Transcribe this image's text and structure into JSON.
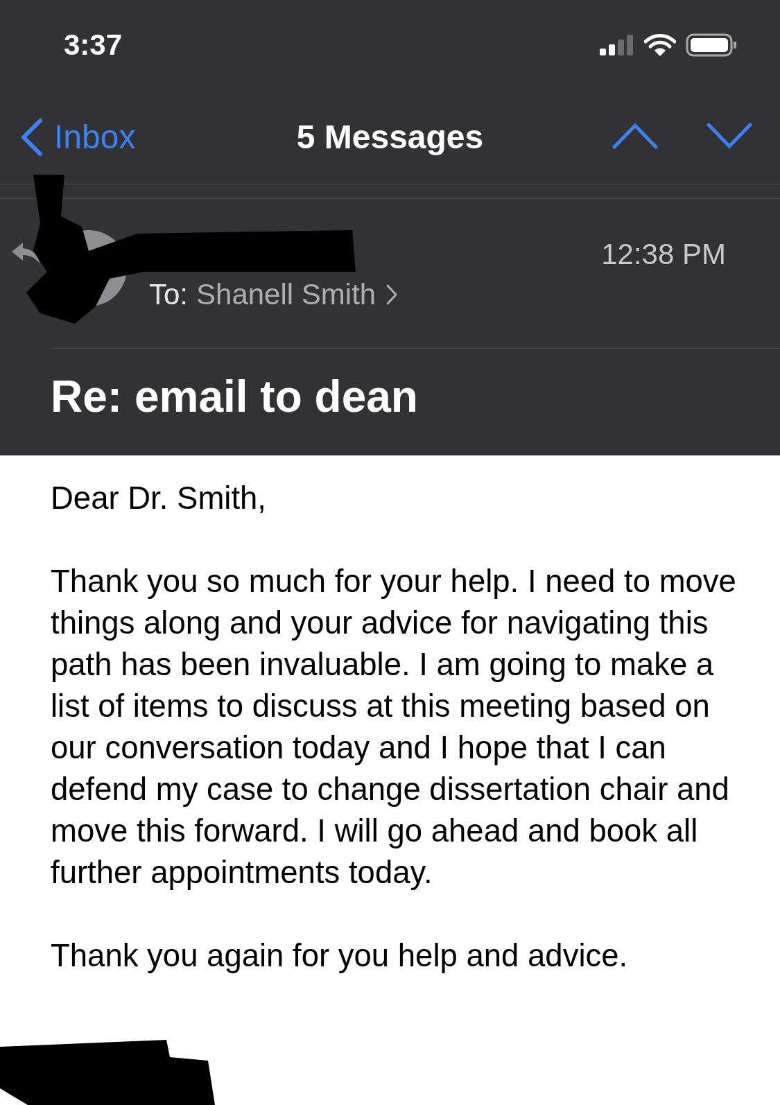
{
  "status_bar": {
    "time": "3:37"
  },
  "nav": {
    "back_label": "Inbox",
    "title": "5 Messages"
  },
  "message": {
    "replied": true,
    "time": "12:38 PM",
    "to_label": "To:",
    "recipient": "Shanell Smith",
    "subject": "Re: email to dean",
    "paragraphs": [
      "Dear Dr. Smith,",
      "Thank you so much for your help. I need to move things along and your advice for navigating this path has been invaluable. I am going to make a list of items to discuss at this meeting based on our conversation today and I hope that I can defend my case to change dissertation chair and move this forward. I will go ahead and book all further appointments today.",
      "Thank you again for you help and advice."
    ]
  }
}
